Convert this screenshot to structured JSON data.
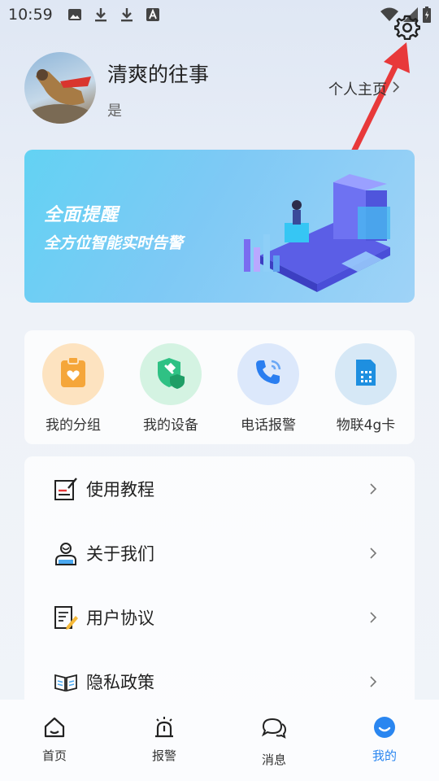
{
  "status_bar": {
    "time": "10:59"
  },
  "profile": {
    "username": "清爽的往事",
    "subtitle": "是",
    "home_link_label": "个人主页"
  },
  "banner": {
    "title": "全面提醒",
    "subtitle": "全方位智能实时告警"
  },
  "quick_actions": [
    {
      "label": "我的分组",
      "icon": "group-icon",
      "bg": "#fde3c0",
      "fg": "#f5a63a"
    },
    {
      "label": "我的设备",
      "icon": "device-shield-icon",
      "bg": "#d4f3e2",
      "fg": "#2fc184"
    },
    {
      "label": "电话报警",
      "icon": "phone-icon",
      "bg": "#dce8fb",
      "fg": "#2a7ef0"
    },
    {
      "label": "物联4g卡",
      "icon": "sim-card-icon",
      "bg": "#d6e8f6",
      "fg": "#1e8fe0"
    }
  ],
  "menu": [
    {
      "label": "使用教程",
      "icon": "tutorial-icon"
    },
    {
      "label": "关于我们",
      "icon": "about-us-icon"
    },
    {
      "label": "用户协议",
      "icon": "user-agreement-icon"
    },
    {
      "label": "隐私政策",
      "icon": "privacy-policy-icon"
    }
  ],
  "bottom_nav": [
    {
      "label": "首页",
      "icon": "home-icon"
    },
    {
      "label": "报警",
      "icon": "alarm-icon"
    },
    {
      "label": "消息",
      "icon": "message-icon"
    },
    {
      "label": "我的",
      "icon": "profile-icon",
      "active": true
    }
  ],
  "colors": {
    "accent": "#2a86f0",
    "arrow": "#e8393a"
  }
}
